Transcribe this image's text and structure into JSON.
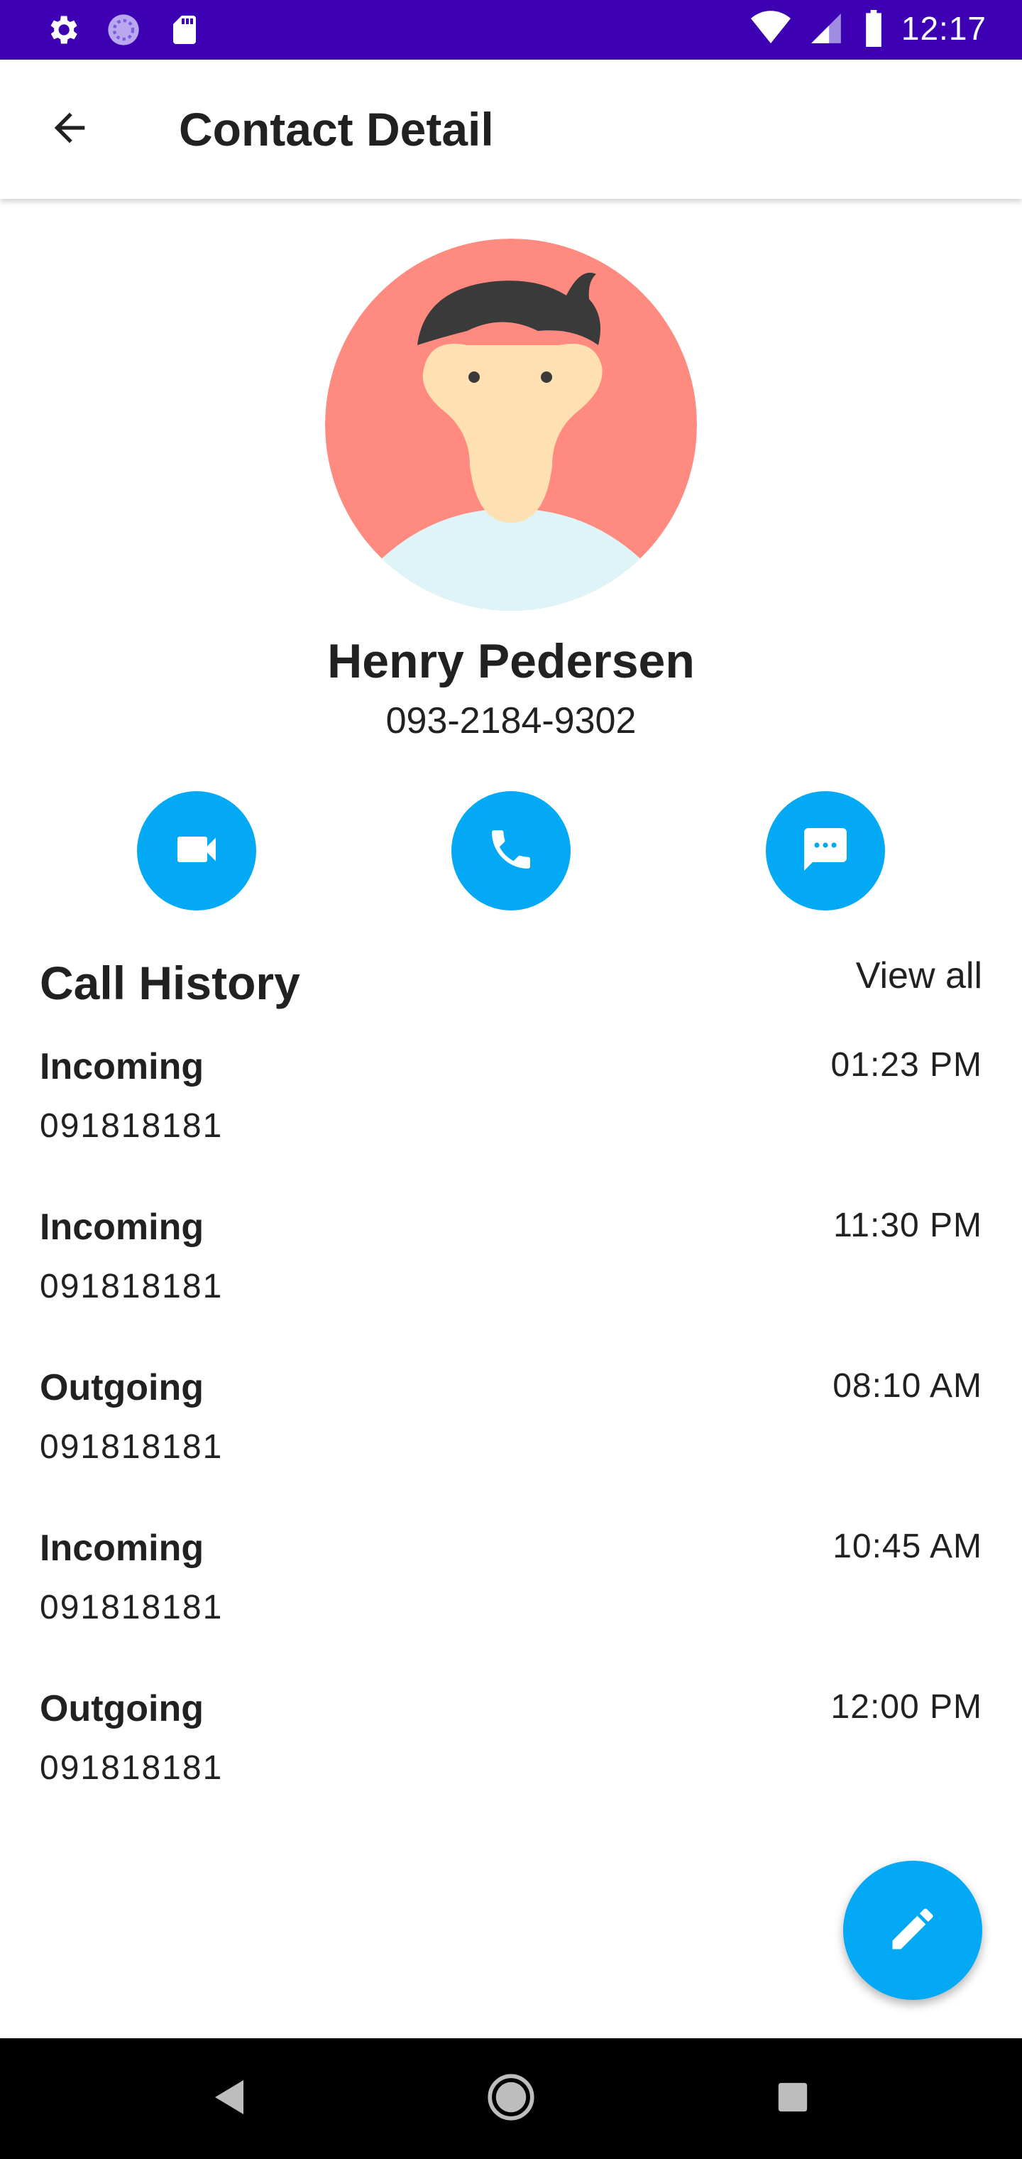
{
  "status_bar": {
    "time": "12:17",
    "icons": [
      "gear-icon",
      "sync-icon",
      "sd-card-icon",
      "wifi-icon",
      "signal-icon",
      "battery-icon"
    ]
  },
  "app_bar": {
    "title": "Contact Detail",
    "back_icon": "arrow-back-icon"
  },
  "contact": {
    "name": "Henry Pedersen",
    "phone": "093-2184-9302"
  },
  "actions": [
    {
      "name": "video-call",
      "icon": "videocam-icon"
    },
    {
      "name": "call",
      "icon": "phone-icon"
    },
    {
      "name": "message",
      "icon": "chat-icon"
    }
  ],
  "call_history": {
    "title": "Call History",
    "view_all": "View all",
    "items": [
      {
        "type": "Incoming",
        "number": "091818181",
        "time": "01:23 PM"
      },
      {
        "type": "Incoming",
        "number": "091818181",
        "time": "11:30 PM"
      },
      {
        "type": "Outgoing",
        "number": "091818181",
        "time": "08:10 AM"
      },
      {
        "type": "Incoming",
        "number": "091818181",
        "time": "10:45 AM"
      },
      {
        "type": "Outgoing",
        "number": "091818181",
        "time": "12:00 PM"
      }
    ]
  },
  "fab": {
    "icon": "edit-icon"
  },
  "colors": {
    "status_bar": "#3e00b3",
    "accent": "#03a9f4",
    "avatar_bg": "#ff8a80",
    "nav_bar": "#000000"
  }
}
